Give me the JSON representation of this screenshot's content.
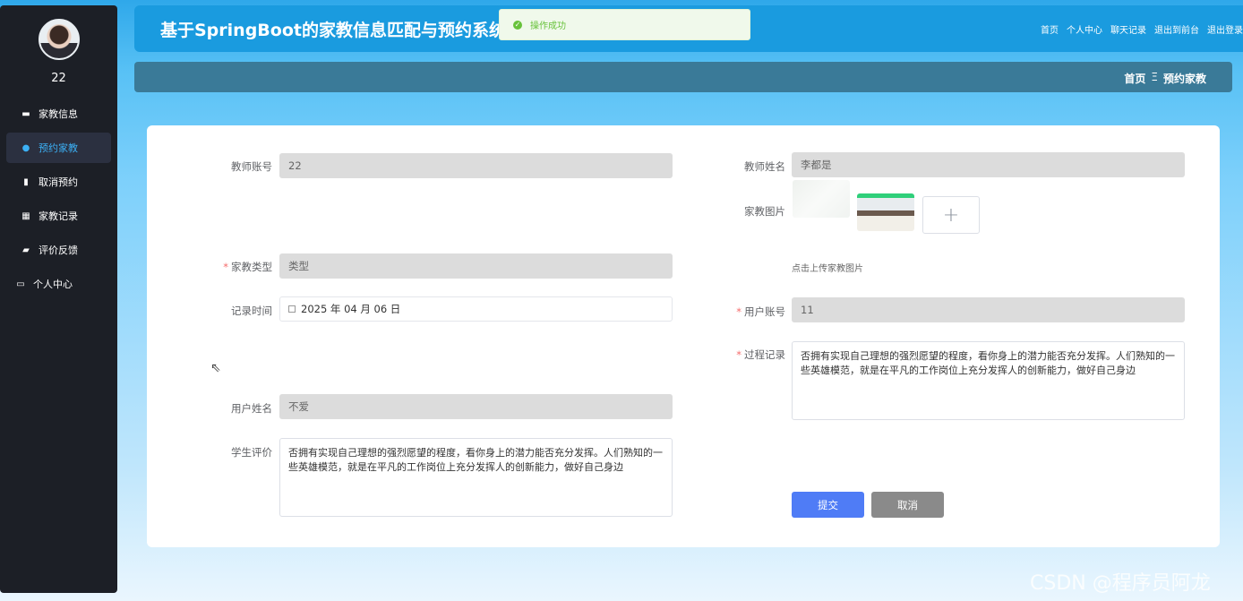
{
  "sidebar": {
    "username": "22",
    "items": [
      {
        "label": "家教信息",
        "icon": "monitor-icon",
        "glyph": "▬"
      },
      {
        "label": "预约家教",
        "icon": "location-icon",
        "glyph": "●"
      },
      {
        "label": "取消预约",
        "icon": "chart-icon",
        "glyph": "▮"
      },
      {
        "label": "家教记录",
        "icon": "grid-icon",
        "glyph": "▦"
      },
      {
        "label": "评价反馈",
        "icon": "briefcase-icon",
        "glyph": "▰"
      },
      {
        "label": "个人中心",
        "icon": "window-icon",
        "glyph": "▭"
      }
    ]
  },
  "header": {
    "title": "基于SpringBoot的家教信息匹配与预约系统",
    "nav": [
      "首页",
      "个人中心",
      "聊天记录",
      "退出到前台",
      "退出登录"
    ]
  },
  "toast": {
    "message": "操作成功"
  },
  "breadcrumb": {
    "home": "首页",
    "separator": "Ξ",
    "current": "预约家教"
  },
  "form": {
    "teacher_account": {
      "label": "教师账号",
      "value": "22"
    },
    "teacher_name": {
      "label": "教师姓名",
      "value": "李都是"
    },
    "tutor_image": {
      "label": "家教图片",
      "hint": "点击上传家教图片",
      "upload_glyph": "+"
    },
    "tutor_type": {
      "label": "家教类型",
      "value": "类型"
    },
    "record_time": {
      "label": "记录时间",
      "value": "2025 年 04 月 06 日"
    },
    "user_account": {
      "label": "用户账号",
      "value": "11"
    },
    "process_record": {
      "label": "过程记录",
      "value": "否拥有实现自己理想的强烈愿望的程度，看你身上的潜力能否充分发挥。人们熟知的一些英雄模范，就是在平凡的工作岗位上充分发挥人的创新能力，做好自己身边"
    },
    "user_name": {
      "label": "用户姓名",
      "value": "不爱"
    },
    "student_review": {
      "label": "学生评价",
      "value": "否拥有实现自己理想的强烈愿望的程度，看你身上的潜力能否充分发挥。人们熟知的一些英雄模范，就是在平凡的工作岗位上充分发挥人的创新能力，做好自己身边"
    },
    "required_mark": "*",
    "submit_label": "提交",
    "cancel_label": "取消"
  },
  "watermark": "CSDN @程序员阿龙",
  "colors": {
    "header": "#1a9bdf",
    "sidebar": "#1c1f26",
    "active_text": "#3cb0f5",
    "primary": "#4f7cf6",
    "success": "#67c23a"
  }
}
